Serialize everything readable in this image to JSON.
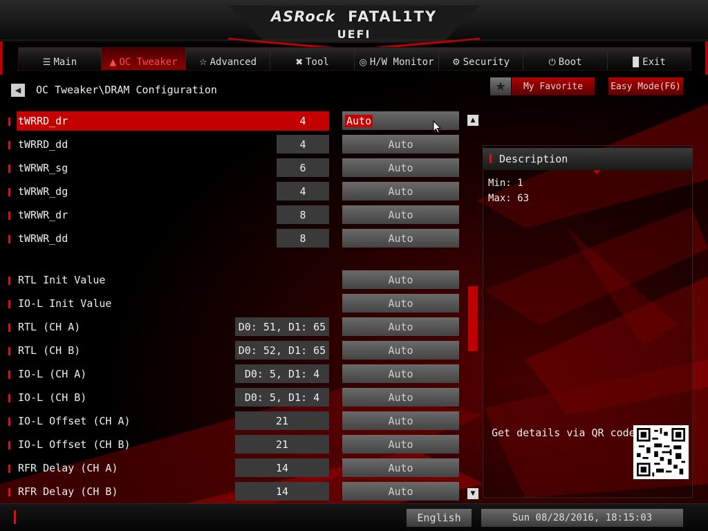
{
  "header": {
    "brand_left": "ASRock",
    "brand_right": "FATAL1TY",
    "subtitle": "UEFI"
  },
  "tabs": [
    {
      "label": "Main",
      "icon": "list-icon",
      "active": false
    },
    {
      "label": "OC Tweaker",
      "icon": "flame-icon",
      "active": true
    },
    {
      "label": "Advanced",
      "icon": "star-icon",
      "active": false
    },
    {
      "label": "Tool",
      "icon": "tools-icon",
      "active": false
    },
    {
      "label": "H/W Monitor",
      "icon": "gauge-icon",
      "active": false
    },
    {
      "label": "Security",
      "icon": "shield-icon",
      "active": false
    },
    {
      "label": "Boot",
      "icon": "power-icon",
      "active": false
    },
    {
      "label": "Exit",
      "icon": "exit-door-icon",
      "active": false
    }
  ],
  "breadcrumb": "OC Tweaker\\DRAM Configuration",
  "buttons": {
    "favorite": "My Favorite",
    "easy_mode": "Easy Mode(F6)"
  },
  "settings": [
    {
      "label": "tWRRD_dr",
      "value": "4",
      "setting": "Auto",
      "selected": true
    },
    {
      "label": "tWRRD_dd",
      "value": "4",
      "setting": "Auto"
    },
    {
      "label": "tWRWR_sg",
      "value": "6",
      "setting": "Auto"
    },
    {
      "label": "tWRWR_dg",
      "value": "4",
      "setting": "Auto"
    },
    {
      "label": "tWRWR_dr",
      "value": "8",
      "setting": "Auto"
    },
    {
      "label": "tWRWR_dd",
      "value": "8",
      "setting": "Auto"
    },
    {
      "label": "RTL Init Value",
      "value": "",
      "setting": "Auto"
    },
    {
      "label": "IO-L Init Value",
      "value": "",
      "setting": "Auto"
    },
    {
      "label": "RTL (CH A)",
      "value": "D0: 51, D1: 65",
      "setting": "Auto"
    },
    {
      "label": "RTL (CH B)",
      "value": "D0: 52, D1: 65",
      "setting": "Auto"
    },
    {
      "label": "IO-L (CH A)",
      "value": "D0: 5, D1: 4",
      "setting": "Auto"
    },
    {
      "label": "IO-L (CH B)",
      "value": "D0: 5, D1: 4",
      "setting": "Auto"
    },
    {
      "label": "IO-L Offset (CH A)",
      "value": "21",
      "setting": "Auto"
    },
    {
      "label": "IO-L Offset (CH B)",
      "value": "21",
      "setting": "Auto"
    },
    {
      "label": "RFR Delay (CH A)",
      "value": "14",
      "setting": "Auto"
    },
    {
      "label": "RFR Delay (CH B)",
      "value": "14",
      "setting": "Auto"
    }
  ],
  "description": {
    "title": "Description",
    "min": "Min: 1",
    "max": "Max: 63",
    "qr_text": "Get details via QR code"
  },
  "footer": {
    "language": "English",
    "datetime": "Sun 08/28/2016, 18:15:03"
  },
  "colors": {
    "accent": "#c40000",
    "background": "#000000"
  }
}
